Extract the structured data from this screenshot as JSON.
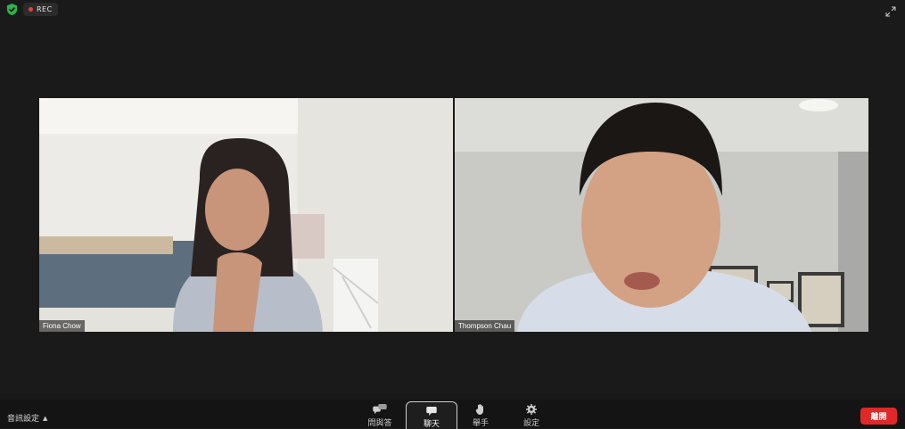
{
  "topbar": {
    "security_icon": "shield-check-icon",
    "rec_label": "REC",
    "fullscreen_icon": "expand-icon"
  },
  "participants": [
    {
      "name": "Fiona Chow"
    },
    {
      "name": "Thompson Chau"
    }
  ],
  "toolbar": {
    "audio_settings_label": "音訊設定",
    "buttons": [
      {
        "label": "問與答",
        "icon": "qa-icon"
      },
      {
        "label": "聊天",
        "icon": "chat-icon"
      },
      {
        "label": "舉手",
        "icon": "raise-hand-icon"
      },
      {
        "label": "設定",
        "icon": "gear-icon"
      }
    ],
    "leave_label": "離開"
  },
  "colors": {
    "background": "#1a1a1a",
    "leave_button": "#e02828",
    "rec_dot": "#e8403a",
    "shield": "#2fb24a"
  }
}
